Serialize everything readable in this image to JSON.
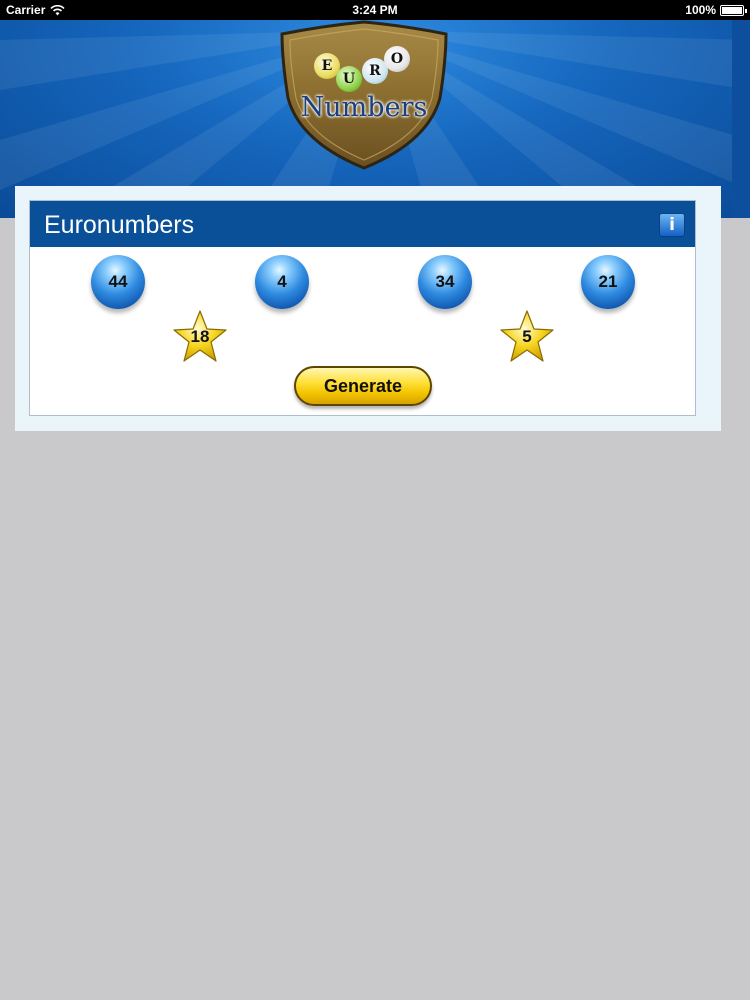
{
  "status_bar": {
    "carrier": "Carrier",
    "time": "3:24 PM",
    "battery": "100%",
    "icons": [
      "wifi-icon",
      "battery-icon"
    ]
  },
  "header": {
    "logo": {
      "letters": [
        "E",
        "U",
        "R",
        "O"
      ],
      "name": "Numbers"
    }
  },
  "card": {
    "title": "Euronumbers",
    "info_button_icon": "info-icon",
    "main_numbers": [
      "44",
      "4",
      "34",
      "21"
    ],
    "lucky_stars": [
      "18",
      "5"
    ],
    "generate_label": "Generate"
  },
  "colors": {
    "header_blue": "#1566bd",
    "card_header": "#0a5099",
    "background": "#c9c9cb",
    "ball_blue": "#2f8be0",
    "star_gold": "#f5cf1a",
    "button_yellow": "#ffe03a"
  }
}
